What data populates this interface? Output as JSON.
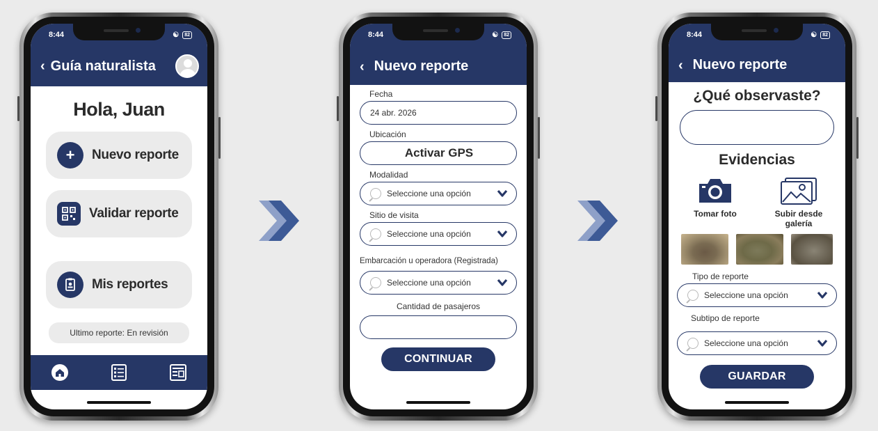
{
  "status": {
    "time": "8:44",
    "battery": "82"
  },
  "screen1": {
    "header_title": "Guía naturalista",
    "greeting": "Hola, Juan",
    "menu": [
      {
        "label": "Nuevo reporte",
        "icon": "plus-icon"
      },
      {
        "label": "Validar reporte",
        "icon": "qr-code-icon"
      },
      {
        "label": "Mis reportes",
        "icon": "clipboard-icon"
      }
    ],
    "last_report": "Ultimo reporte: En revisión",
    "nav": [
      "home-icon",
      "list-icon",
      "reports-icon"
    ]
  },
  "screen2": {
    "header_title": "Nuevo reporte",
    "fecha_label": "Fecha",
    "fecha_value": "24 abr. 2026",
    "ubicacion_label": "Ubicación",
    "gps_button": "Activar GPS",
    "modalidad_label": "Modalidad",
    "modalidad_value": "Seleccione una opción",
    "sitio_label": "Sitio de visita",
    "sitio_value": "Seleccione una opción",
    "embarcacion_label": "Embarcación u operadora (Registrada)",
    "embarcacion_value": "Seleccione una opción",
    "pasajeros_label": "Cantidad de pasajeros",
    "pasajeros_value": "",
    "continue_button": "CONTINUAR"
  },
  "screen3": {
    "header_title": "Nuevo reporte",
    "question": "¿Qué observaste?",
    "observation_value": "",
    "evidence_title": "Evidencias",
    "take_photo": "Tomar foto",
    "upload_gallery": "Subir desde galería",
    "tipo_label": "Tipo de reporte",
    "tipo_value": "Seleccione una opción",
    "subtipo_label": "Subtipo de reporte",
    "subtipo_value": "Seleccione una opción",
    "save_button": "GUARDAR"
  },
  "colors": {
    "brand": "#263766",
    "card": "#ebebeb",
    "arrow": "#3d5a96"
  }
}
